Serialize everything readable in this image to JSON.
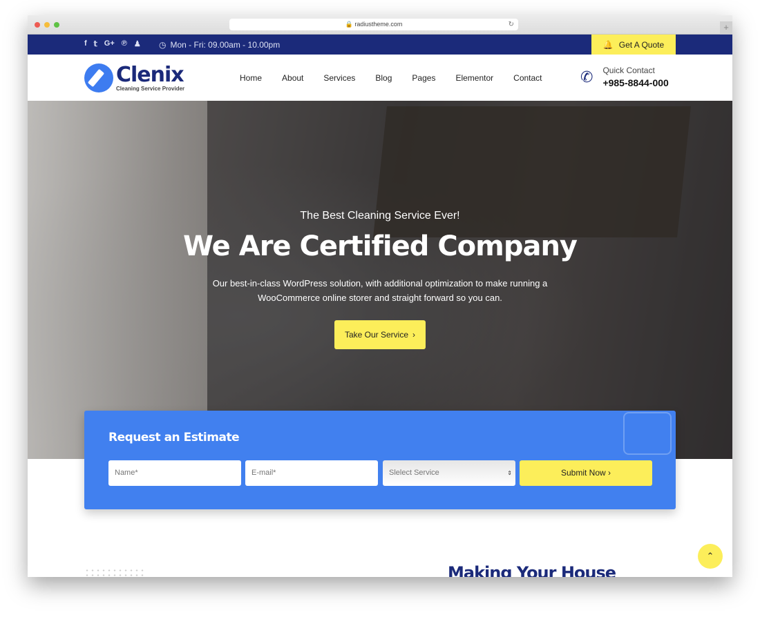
{
  "browser": {
    "url": "radiustheme.com"
  },
  "topbar": {
    "social": [
      "f",
      "𝕥",
      "G+",
      "℗",
      "♟"
    ],
    "social_names": [
      "facebook",
      "twitter",
      "google-plus",
      "pinterest",
      "snapchat"
    ],
    "hours": "Mon - Fri: 09.00am - 10.00pm",
    "quote": "Get A Quote"
  },
  "header": {
    "brand": "Clenix",
    "tagline": "Cleaning Service Provider",
    "menu": [
      "Home",
      "About",
      "Services",
      "Blog",
      "Pages",
      "Elementor",
      "Contact"
    ],
    "contact_label": "Quick Contact",
    "phone": "+985-8844-000"
  },
  "hero": {
    "kicker": "The Best Cleaning Service Ever!",
    "title": "We Are Certified Company",
    "text1": "Our best-in-class WordPress solution, with additional optimization to make running a",
    "text2": "WooCommerce online storer and straight forward so you can.",
    "cta": "Take Our Service"
  },
  "estimate": {
    "title": "Request an Estimate",
    "name_placeholder": "Name*",
    "email_placeholder": "E-mail*",
    "select": "Slelect Service",
    "submit": "Submit Now"
  },
  "next_section": {
    "title": "Making Your House"
  },
  "colors": {
    "navy": "#1b2a7a",
    "yellow": "#fcee5a",
    "blue": "#4180ef"
  }
}
